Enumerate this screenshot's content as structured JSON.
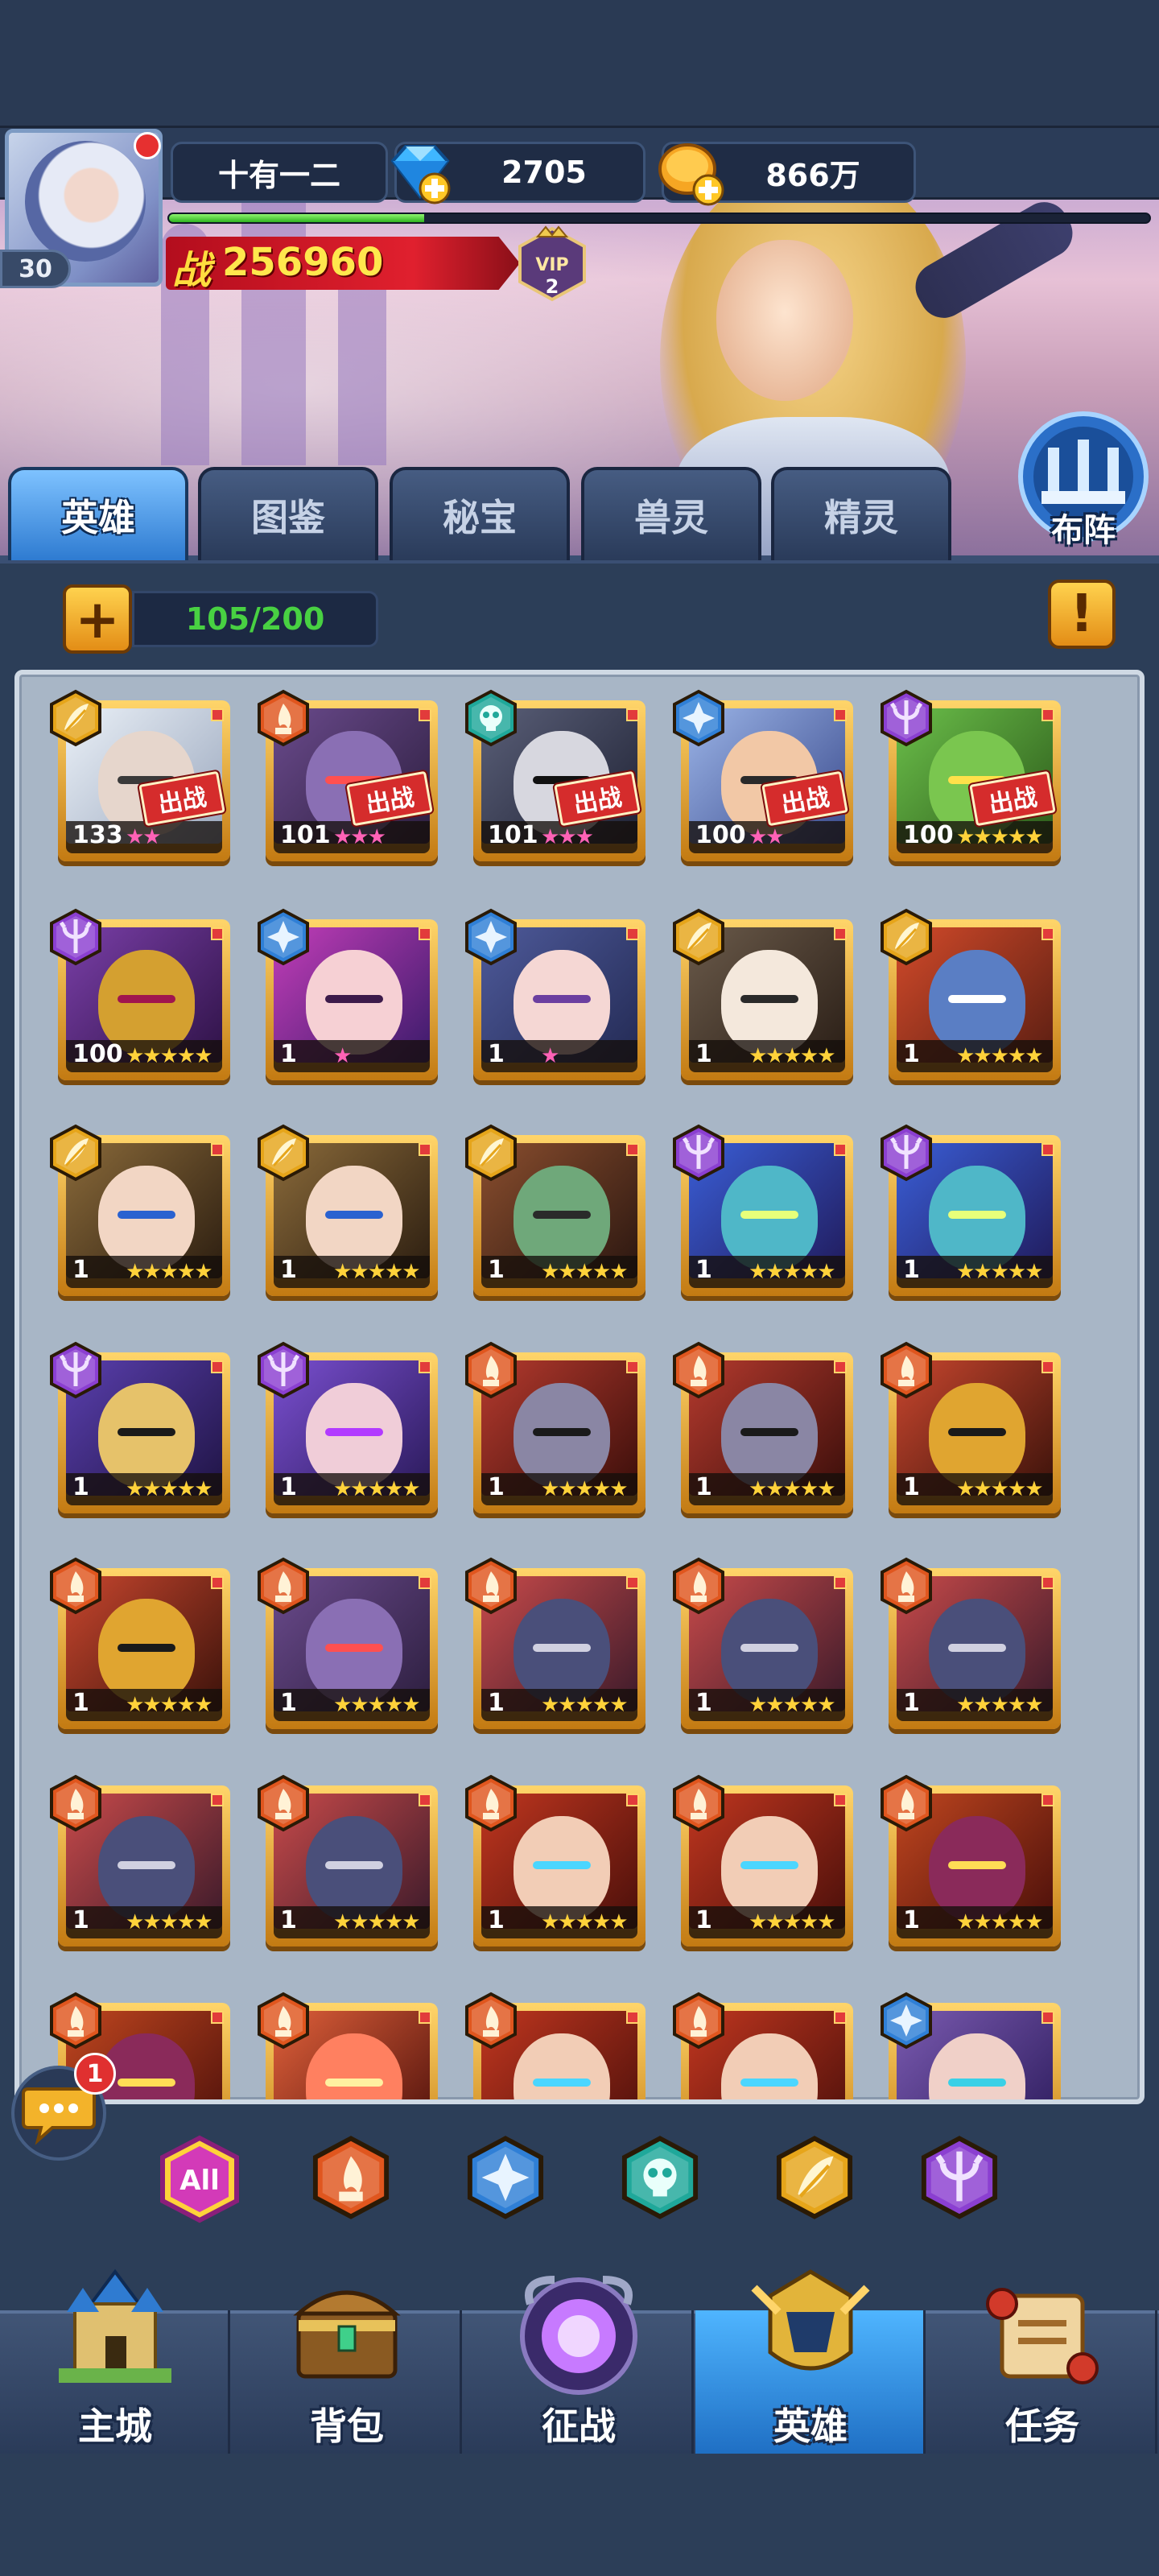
{
  "player": {
    "name": "十有一二",
    "level": "30",
    "gems": "2705",
    "gold": "866万",
    "power_label": "战",
    "power": "256960",
    "vip": "VIP",
    "vip_level": "2",
    "exp_progress": 0.26
  },
  "formation": {
    "label": "布阵"
  },
  "tabs": [
    {
      "label": "英雄",
      "active": true
    },
    {
      "label": "图鉴",
      "active": false
    },
    {
      "label": "秘宝",
      "active": false
    },
    {
      "label": "兽灵",
      "active": false
    },
    {
      "label": "精灵",
      "active": false
    }
  ],
  "capacity": {
    "plus": "+",
    "text": "105/200",
    "alert": "!"
  },
  "deploy_label": "出战",
  "heroes": [
    {
      "level": "133",
      "stars": 2,
      "star_color": "pink",
      "faction": "light",
      "deployed": true,
      "art": "silver"
    },
    {
      "level": "101",
      "stars": 3,
      "star_color": "pink",
      "faction": "fire",
      "deployed": true,
      "art": "purple-hat"
    },
    {
      "level": "101",
      "stars": 3,
      "star_color": "pink",
      "faction": "undead",
      "deployed": true,
      "art": "skull-mask"
    },
    {
      "level": "100",
      "stars": 2,
      "star_color": "pink",
      "faction": "water",
      "deployed": true,
      "art": "bearded"
    },
    {
      "level": "100",
      "stars": 5,
      "star_color": "gold",
      "faction": "dark",
      "deployed": true,
      "art": "goblin"
    },
    {
      "level": "100",
      "stars": 5,
      "star_color": "gold",
      "faction": "dark",
      "deployed": false,
      "art": "masked-gold"
    },
    {
      "level": "1",
      "stars": 1,
      "star_color": "pink",
      "faction": "water",
      "deployed": false,
      "art": "pink-hair"
    },
    {
      "level": "1",
      "stars": 1,
      "star_color": "pink",
      "faction": "water",
      "deployed": false,
      "art": "silver-witch"
    },
    {
      "level": "1",
      "stars": 5,
      "star_color": "gold",
      "faction": "light",
      "deployed": false,
      "art": "white-hair"
    },
    {
      "level": "1",
      "stars": 5,
      "star_color": "gold",
      "faction": "light",
      "deployed": false,
      "art": "blue-troll"
    },
    {
      "level": "1",
      "stars": 5,
      "star_color": "gold",
      "faction": "light",
      "deployed": false,
      "art": "hood-gold"
    },
    {
      "level": "1",
      "stars": 5,
      "star_color": "gold",
      "faction": "light",
      "deployed": false,
      "art": "hood-gold"
    },
    {
      "level": "1",
      "stars": 5,
      "star_color": "gold",
      "faction": "light",
      "deployed": false,
      "art": "elf"
    },
    {
      "level": "1",
      "stars": 5,
      "star_color": "gold",
      "faction": "dark",
      "deployed": false,
      "art": "medusa"
    },
    {
      "level": "1",
      "stars": 5,
      "star_color": "gold",
      "faction": "dark",
      "deployed": false,
      "art": "medusa"
    },
    {
      "level": "1",
      "stars": 5,
      "star_color": "gold",
      "faction": "dark",
      "deployed": false,
      "art": "jester"
    },
    {
      "level": "1",
      "stars": 5,
      "star_color": "gold",
      "faction": "dark",
      "deployed": false,
      "art": "sorceress"
    },
    {
      "level": "1",
      "stars": 5,
      "star_color": "gold",
      "faction": "fire",
      "deployed": false,
      "art": "skull-pirate"
    },
    {
      "level": "1",
      "stars": 5,
      "star_color": "gold",
      "faction": "fire",
      "deployed": false,
      "art": "skull-pirate"
    },
    {
      "level": "1",
      "stars": 5,
      "star_color": "gold",
      "faction": "fire",
      "deployed": false,
      "art": "gold-knight"
    },
    {
      "level": "1",
      "stars": 5,
      "star_color": "gold",
      "faction": "fire",
      "deployed": false,
      "art": "gold-knight"
    },
    {
      "level": "1",
      "stars": 5,
      "star_color": "gold",
      "faction": "fire",
      "deployed": false,
      "art": "purple-hat"
    },
    {
      "level": "1",
      "stars": 5,
      "star_color": "gold",
      "faction": "fire",
      "deployed": false,
      "art": "ghoul"
    },
    {
      "level": "1",
      "stars": 5,
      "star_color": "gold",
      "faction": "fire",
      "deployed": false,
      "art": "ghoul"
    },
    {
      "level": "1",
      "stars": 5,
      "star_color": "gold",
      "faction": "fire",
      "deployed": false,
      "art": "ghoul"
    },
    {
      "level": "1",
      "stars": 5,
      "star_color": "gold",
      "faction": "fire",
      "deployed": false,
      "art": "ghoul"
    },
    {
      "level": "1",
      "stars": 5,
      "star_color": "gold",
      "faction": "fire",
      "deployed": false,
      "art": "ghoul"
    },
    {
      "level": "1",
      "stars": 5,
      "star_color": "gold",
      "faction": "fire",
      "deployed": false,
      "art": "red-mask"
    },
    {
      "level": "1",
      "stars": 5,
      "star_color": "gold",
      "faction": "fire",
      "deployed": false,
      "art": "red-mask"
    },
    {
      "level": "1",
      "stars": 5,
      "star_color": "gold",
      "faction": "fire",
      "deployed": false,
      "art": "demon"
    },
    {
      "level": "",
      "stars": 0,
      "star_color": "gold",
      "faction": "fire",
      "deployed": false,
      "art": "demon"
    },
    {
      "level": "",
      "stars": 0,
      "star_color": "gold",
      "faction": "fire",
      "deployed": false,
      "art": "fire-beast"
    },
    {
      "level": "",
      "stars": 0,
      "star_color": "gold",
      "faction": "fire",
      "deployed": false,
      "art": "red-mask"
    },
    {
      "level": "",
      "stars": 0,
      "star_color": "gold",
      "faction": "fire",
      "deployed": false,
      "art": "red-mask"
    },
    {
      "level": "",
      "stars": 0,
      "star_color": "gold",
      "faction": "water",
      "deployed": false,
      "art": "goggles"
    }
  ],
  "chat": {
    "icon": "chat-bubble-icon",
    "badge": "1"
  },
  "filters": [
    {
      "id": "all",
      "label": "All",
      "active": true
    },
    {
      "id": "fire",
      "label": "",
      "active": false
    },
    {
      "id": "water",
      "label": "",
      "active": false
    },
    {
      "id": "undead",
      "label": "",
      "active": false
    },
    {
      "id": "light",
      "label": "",
      "active": false
    },
    {
      "id": "dark",
      "label": "",
      "active": false
    }
  ],
  "nav": [
    {
      "label": "主城",
      "icon": "castle-icon",
      "active": false
    },
    {
      "label": "背包",
      "icon": "treasure-chest-icon",
      "active": false
    },
    {
      "label": "征战",
      "icon": "dragon-portal-icon",
      "active": false
    },
    {
      "label": "英雄",
      "icon": "hero-helmet-icon",
      "active": true
    },
    {
      "label": "任务",
      "icon": "scroll-icon",
      "active": false
    }
  ],
  "colors": {
    "fire": "#e0561e",
    "water": "#2f7fd6",
    "undead": "#1fa89a",
    "light": "#e6a51a",
    "dark": "#8b3fd1"
  }
}
